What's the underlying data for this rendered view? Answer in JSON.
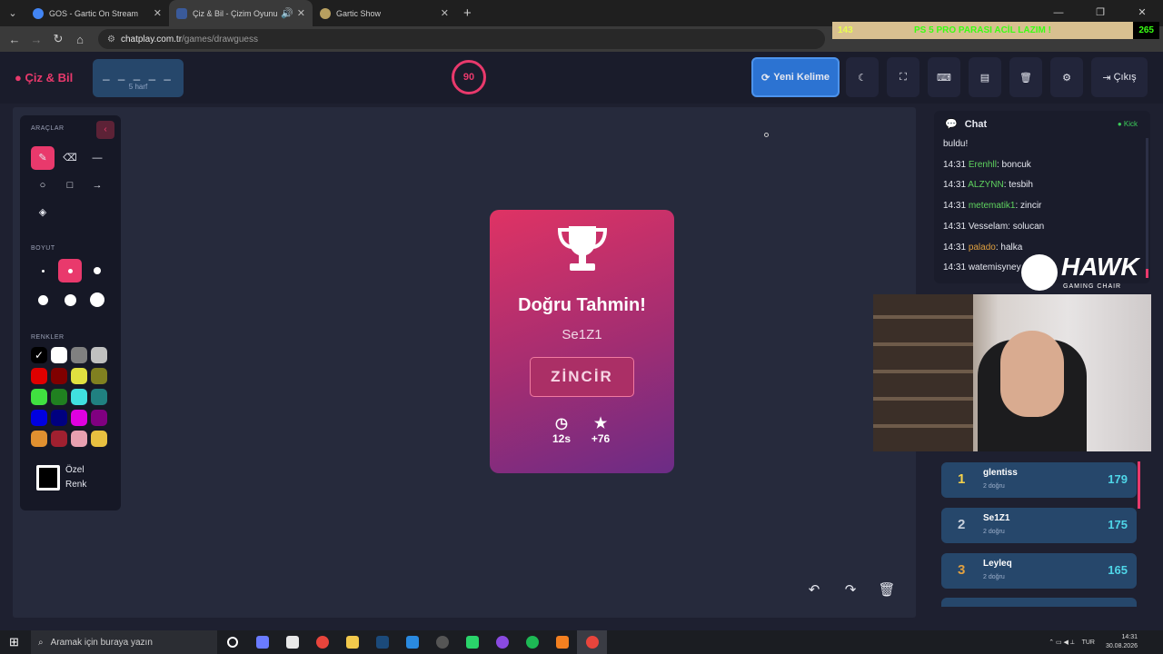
{
  "browser": {
    "tabs": [
      {
        "title": "GOS - Gartic On Stream",
        "active": false
      },
      {
        "title": "Çiz & Bil - Çizim Oyunu",
        "active": true
      },
      {
        "title": "Gartic Show",
        "active": false
      }
    ],
    "url_domain": "chatplay.com.tr",
    "url_path": "/games/drawguess"
  },
  "ticker": {
    "left": "143",
    "middle": "PS 5 PRO PARASI ACİL LAZIM !",
    "right": "265"
  },
  "header": {
    "logo": "Çiz & Bil",
    "word_mask": "_ _ _ _ _",
    "word_hint": "5 harf",
    "timer": "90",
    "new_word": "Yeni Kelime",
    "logout": "Çıkış"
  },
  "tools": {
    "tools_label": "ARAÇLAR",
    "size_label": "BOYUT",
    "colors_label": "RENKLER",
    "custom_color": "Özel",
    "custom_color_2": "Renk",
    "colors": [
      "#000000",
      "#ffffff",
      "#808080",
      "#c0c0c0",
      "#e00000",
      "#800000",
      "#e0e040",
      "#808020",
      "#40e040",
      "#208020",
      "#40e0e0",
      "#208080",
      "#0000e0",
      "#000080",
      "#e000e0",
      "#800080",
      "#e09030",
      "#a02030",
      "#e8a0b0",
      "#e8c040"
    ]
  },
  "result": {
    "title": "Doğru Tahmin!",
    "player": "Se1Z1",
    "answer": "ZİNCİR",
    "time": "12s",
    "points": "+76"
  },
  "chat": {
    "title": "Chat",
    "source": "Kick",
    "messages": [
      {
        "time": "",
        "user": "",
        "text": "buldu!",
        "color": "#e6e8f0"
      },
      {
        "time": "14:31",
        "user": "Erenhll",
        "text": ": boncuk",
        "color": "#5fd35f"
      },
      {
        "time": "14:31",
        "user": "ALZYNN",
        "text": ": tesbih",
        "color": "#5fd35f"
      },
      {
        "time": "14:31",
        "user": "metematik1",
        "text": ": zincir",
        "color": "#5fd35f"
      },
      {
        "time": "14:31",
        "user": "Vesselam",
        "text": ": solucan",
        "color": "#e6e8f0"
      },
      {
        "time": "14:31",
        "user": "palado",
        "text": ": halka",
        "color": "#e0a040"
      },
      {
        "time": "14:31",
        "user": "watemisyney",
        "text": "",
        "color": "#e6e8f0"
      }
    ]
  },
  "sponsor": {
    "name": "HAWK",
    "sub": "GAMING CHAIR"
  },
  "leaderboard": [
    {
      "rank": "1",
      "name": "glentiss",
      "sub": "2 doğru",
      "score": "179",
      "rank_color": "#f5d24a"
    },
    {
      "rank": "2",
      "name": "Se1Z1",
      "sub": "2 doğru",
      "score": "175",
      "rank_color": "#c8d0dc"
    },
    {
      "rank": "3",
      "name": "Leyleq",
      "sub": "2 doğru",
      "score": "165",
      "rank_color": "#e0a040"
    }
  ],
  "taskbar": {
    "search": "Aramak için buraya yazın",
    "lang": "TUR",
    "time": "14:31",
    "date": "30.08.2026"
  }
}
